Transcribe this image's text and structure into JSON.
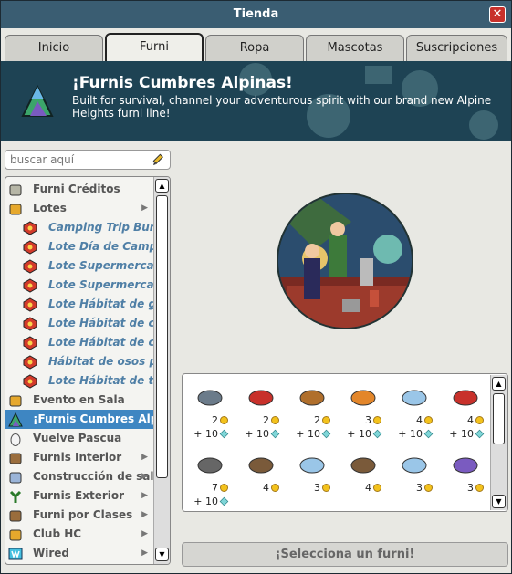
{
  "window": {
    "title": "Tienda",
    "close_label": "✕"
  },
  "tabs": [
    {
      "label": "Inicio"
    },
    {
      "label": "Furni"
    },
    {
      "label": "Ropa"
    },
    {
      "label": "Mascotas"
    },
    {
      "label": "Suscripciones"
    }
  ],
  "active_tab": "Furni",
  "banner": {
    "title": "¡Furnis Cumbres Alpinas!",
    "description": "Built for survival, channel your adventurous spirit with our brand new Alpine Heights furni line!"
  },
  "search": {
    "placeholder": "buscar aquí",
    "value": ""
  },
  "categories": [
    {
      "label": "Furni Créditos",
      "icon": "coins-stack-icon",
      "sub": false,
      "arrow": false
    },
    {
      "label": "Lotes",
      "icon": "bundle-icon",
      "sub": false,
      "arrow": true
    },
    {
      "label": "Camping Trip Bundle",
      "icon": "bundle-hex-icon",
      "sub": true
    },
    {
      "label": "Lote Día de Camping",
      "icon": "bundle-hex-icon",
      "sub": true
    },
    {
      "label": "Lote Supermercado",
      "icon": "bundle-hex-icon",
      "sub": true
    },
    {
      "label": "Lote Supermercado",
      "icon": "bundle-hex-icon",
      "sub": true
    },
    {
      "label": "Lote Hábitat de gatitos",
      "icon": "bundle-hex-icon",
      "sub": true
    },
    {
      "label": "Lote Hábitat de cachorros",
      "icon": "bundle-hex-icon",
      "sub": true
    },
    {
      "label": "Lote Hábitat de cerditos",
      "icon": "bundle-hex-icon",
      "sub": true
    },
    {
      "label": "Hábitat de osos polares",
      "icon": "bundle-hex-icon",
      "sub": true
    },
    {
      "label": "Lote Hábitat de terrier",
      "icon": "bundle-hex-icon",
      "sub": true
    },
    {
      "label": "Evento en Sala",
      "icon": "event-icon",
      "sub": false,
      "arrow": false
    },
    {
      "label": "¡Furnis Cumbres Alpinas!",
      "icon": "mountain-icon",
      "sub": false,
      "arrow": false,
      "selected": true
    },
    {
      "label": "Vuelve Pascua",
      "icon": "egg-icon",
      "sub": false,
      "arrow": false
    },
    {
      "label": "Furnis Interior",
      "icon": "chair-icon",
      "sub": false,
      "arrow": true
    },
    {
      "label": "Construcción de salas",
      "icon": "door-icon",
      "sub": false,
      "arrow": true
    },
    {
      "label": "Furnis Exterior",
      "icon": "plant-icon",
      "sub": false,
      "arrow": true
    },
    {
      "label": "Furni por Clases",
      "icon": "sofa-icon",
      "sub": false,
      "arrow": true
    },
    {
      "label": "Club HC",
      "icon": "hc-icon",
      "sub": false,
      "arrow": true
    },
    {
      "label": "Wired",
      "icon": "wired-icon",
      "sub": false,
      "arrow": true
    }
  ],
  "items": [
    {
      "icon": "camping-stove-icon",
      "price": "2",
      "diamonds": "+ 10"
    },
    {
      "icon": "red-case-icon",
      "price": "2",
      "diamonds": "+ 10"
    },
    {
      "icon": "campfire-food-icon",
      "price": "2",
      "diamonds": "+ 10"
    },
    {
      "icon": "kayak-icon",
      "price": "3",
      "diamonds": "+ 10"
    },
    {
      "icon": "sleeping-roll-icon",
      "price": "4",
      "diamonds": "+ 10"
    },
    {
      "icon": "first-aid-kit-icon",
      "price": "4",
      "diamonds": "+ 10"
    },
    {
      "icon": "fishing-rod-icon",
      "price": "7",
      "diamonds": "+ 10"
    },
    {
      "icon": "wooden-fence-icon",
      "price": "4",
      "diamonds": ""
    },
    {
      "icon": "ice-blocks-icon",
      "price": "3",
      "diamonds": ""
    },
    {
      "icon": "logs-icon",
      "price": "4",
      "diamonds": ""
    },
    {
      "icon": "blue-mat-icon",
      "price": "3",
      "diamonds": ""
    },
    {
      "icon": "lavender-icon",
      "price": "3",
      "diamonds": ""
    }
  ],
  "select_button_label": "¡Selecciona un furni!",
  "colors": {
    "selected": "#3e86c2",
    "banner_bg": "#1e4354",
    "titlebar": "#3a5d72",
    "subcategory_text": "#4f7fa6"
  }
}
